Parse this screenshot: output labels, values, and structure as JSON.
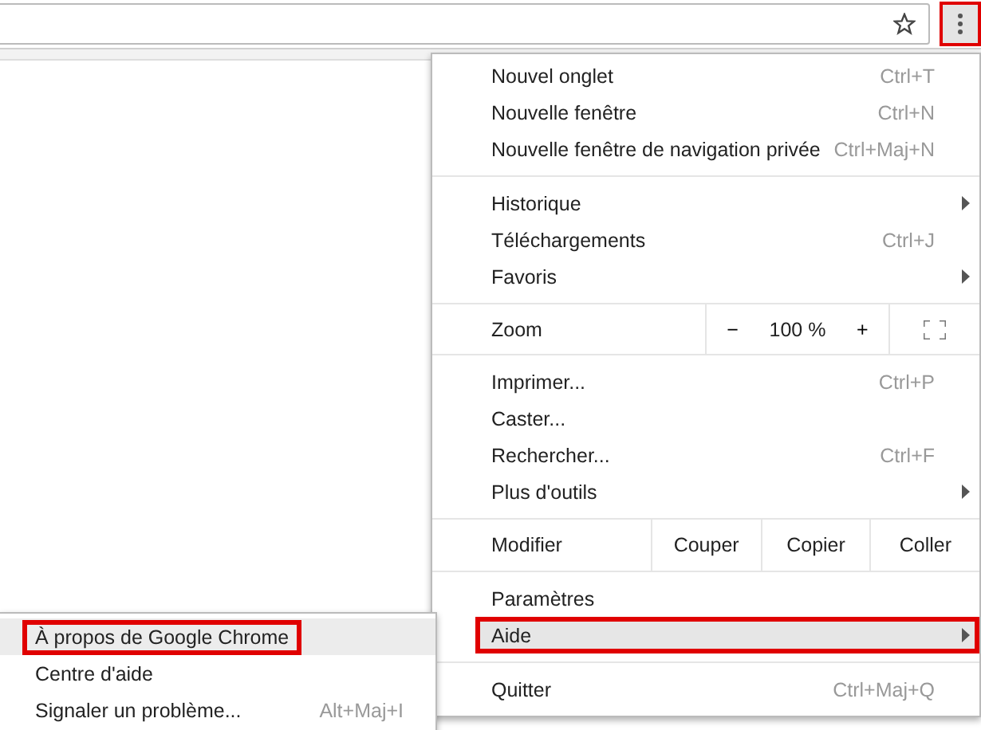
{
  "toolbar": {
    "menu_button_outlined": true
  },
  "menu": {
    "sections": [
      {
        "items": [
          {
            "kind": "item",
            "label": "Nouvel onglet",
            "shortcut": "Ctrl+T",
            "submenu": false,
            "selected": false,
            "outlined": false
          },
          {
            "kind": "item",
            "label": "Nouvelle fenêtre",
            "shortcut": "Ctrl+N",
            "submenu": false,
            "selected": false,
            "outlined": false
          },
          {
            "kind": "item",
            "label": "Nouvelle fenêtre de navigation privée",
            "shortcut": "Ctrl+Maj+N",
            "submenu": false,
            "selected": false,
            "outlined": false
          }
        ]
      },
      {
        "items": [
          {
            "kind": "item",
            "label": "Historique",
            "submenu": true,
            "selected": false,
            "outlined": false
          },
          {
            "kind": "item",
            "label": "Téléchargements",
            "shortcut": "Ctrl+J",
            "submenu": false,
            "selected": false,
            "outlined": false
          },
          {
            "kind": "item",
            "label": "Favoris",
            "submenu": true,
            "selected": false,
            "outlined": false
          }
        ]
      },
      {
        "items": [
          {
            "kind": "zoom",
            "label": "Zoom",
            "minus": "−",
            "value": "100 %",
            "plus": "+"
          }
        ]
      },
      {
        "items": [
          {
            "kind": "item",
            "label": "Imprimer...",
            "shortcut": "Ctrl+P",
            "submenu": false,
            "selected": false,
            "outlined": false
          },
          {
            "kind": "item",
            "label": "Caster...",
            "submenu": false,
            "selected": false,
            "outlined": false
          },
          {
            "kind": "item",
            "label": "Rechercher...",
            "shortcut": "Ctrl+F",
            "submenu": false,
            "selected": false,
            "outlined": false
          },
          {
            "kind": "item",
            "label": "Plus d'outils",
            "submenu": true,
            "selected": false,
            "outlined": false
          }
        ]
      },
      {
        "items": [
          {
            "kind": "edit",
            "label": "Modifier",
            "buttons": [
              "Couper",
              "Copier",
              "Coller"
            ]
          }
        ]
      },
      {
        "items": [
          {
            "kind": "item",
            "label": "Paramètres",
            "submenu": false,
            "selected": false,
            "outlined": false
          },
          {
            "kind": "item",
            "label": "Aide",
            "submenu": true,
            "selected": true,
            "outlined": true
          }
        ]
      },
      {
        "items": [
          {
            "kind": "item",
            "label": "Quitter",
            "shortcut": "Ctrl+Maj+Q",
            "submenu": false,
            "selected": false,
            "outlined": false
          }
        ]
      }
    ]
  },
  "submenu": {
    "items": [
      {
        "label": "À propos de Google Chrome",
        "selected": true,
        "outlined": true
      },
      {
        "label": "Centre d'aide",
        "selected": false,
        "outlined": false
      },
      {
        "label": "Signaler un problème...",
        "shortcut": "Alt+Maj+I",
        "selected": false,
        "outlined": false
      }
    ]
  }
}
